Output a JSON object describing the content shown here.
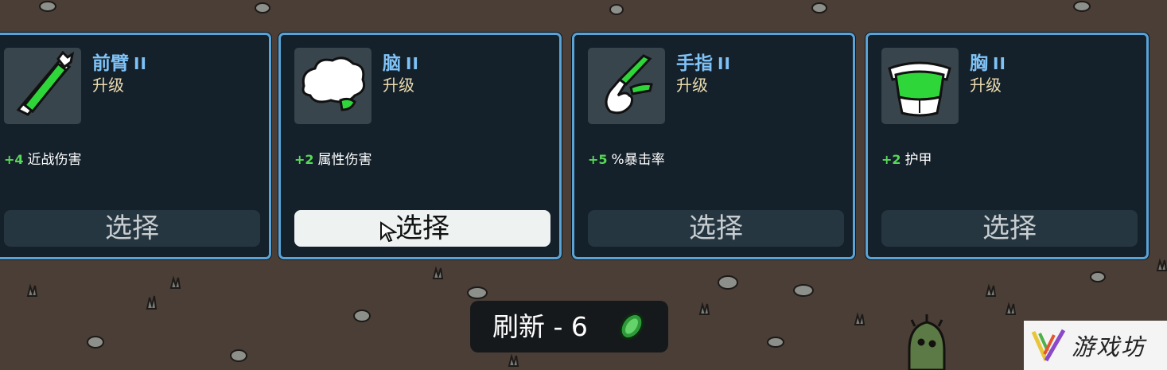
{
  "colors": {
    "card_border": "#5aa3d6",
    "card_bg": "#14202a",
    "item_name": "#7fc2f6",
    "upgrade_label": "#ecdcae",
    "stat_positive": "#58d858",
    "button_bg": "#263641",
    "button_active_bg": "#eef2f1",
    "ground": "#4a3e37"
  },
  "cards": [
    {
      "name": "前臂",
      "tier": "II",
      "sub": "升级",
      "stat_value": "+4",
      "stat_label": "近战伤害",
      "button": "选择",
      "icon": "forearm-icon",
      "highlighted": false
    },
    {
      "name": "脑",
      "tier": "II",
      "sub": "升级",
      "stat_value": "+2",
      "stat_label": "属性伤害",
      "button": "选择",
      "icon": "brain-icon",
      "highlighted": true
    },
    {
      "name": "手指",
      "tier": "II",
      "sub": "升级",
      "stat_value": "+5",
      "stat_label": "%暴击率",
      "button": "选择",
      "icon": "finger-icon",
      "highlighted": false
    },
    {
      "name": "胸",
      "tier": "II",
      "sub": "升级",
      "stat_value": "+2",
      "stat_label": "护甲",
      "button": "选择",
      "icon": "chest-icon",
      "highlighted": false
    }
  ],
  "refresh": {
    "label": "刷新 - 6",
    "currency_icon": "material-coin-icon"
  },
  "watermark": {
    "text": "游戏坊",
    "logo_icon": "youxifang-logo-icon"
  }
}
